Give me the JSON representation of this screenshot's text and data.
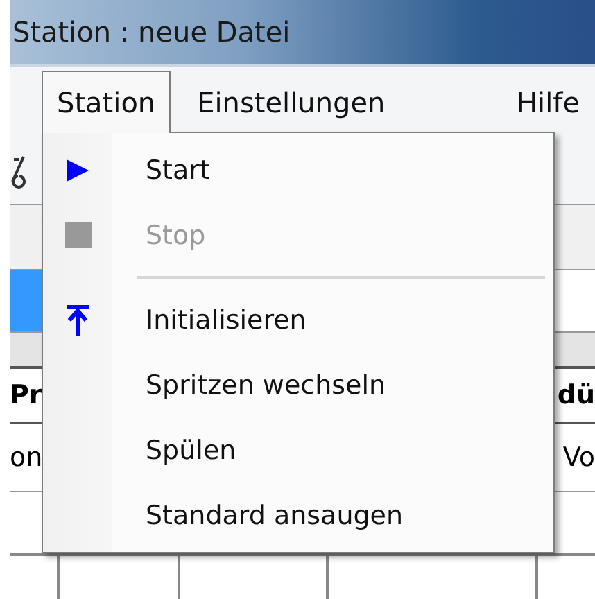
{
  "window": {
    "title": "Station : neue Datei"
  },
  "menu_bar": [
    {
      "label": "Station",
      "selected": true
    },
    {
      "label": "Einstellungen",
      "selected": false
    },
    {
      "label": "Hilfe",
      "selected": false
    }
  ],
  "dropdown": [
    {
      "kind": "play",
      "label": "Start",
      "disabled": false
    },
    {
      "kind": "stop",
      "label": "Stop",
      "disabled": true
    },
    {
      "kind": "separator"
    },
    {
      "kind": "top",
      "label": "Initialisieren",
      "disabled": false
    },
    {
      "kind": "text",
      "label": "Spritzen wechseln",
      "disabled": false
    },
    {
      "kind": "text",
      "label": "Spülen",
      "disabled": false
    },
    {
      "kind": "text",
      "label": "Standard ansaugen",
      "disabled": false
    }
  ],
  "table": {
    "rows": [
      {
        "selected": false
      },
      {
        "selected": true
      }
    ],
    "headers": [
      "Pr",
      "dü"
    ],
    "cells": [
      "on",
      "Vo"
    ]
  }
}
